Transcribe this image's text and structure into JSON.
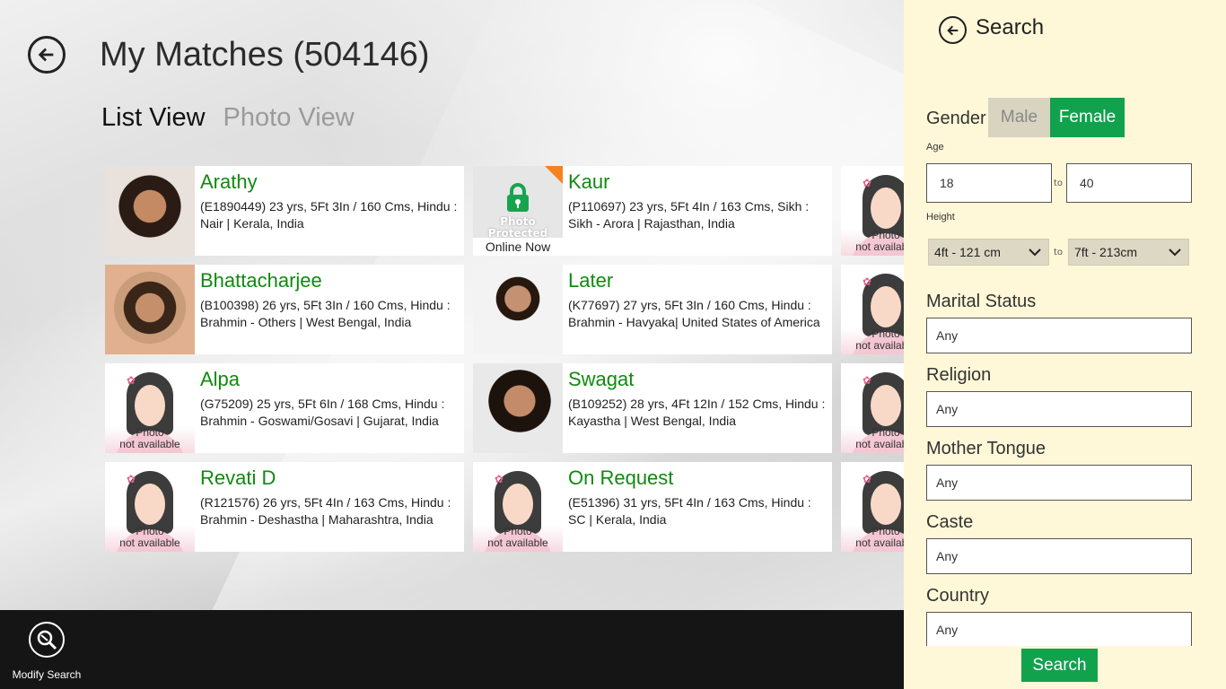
{
  "page": {
    "title": "My Matches (504146)",
    "views": [
      {
        "label": "List View",
        "active": true
      },
      {
        "label": "Photo View",
        "active": false
      }
    ]
  },
  "photo_placeholder": {
    "line1": "Photo",
    "line2": "not available"
  },
  "protected_photo": {
    "text": "Photo Protected",
    "status": "Online Now"
  },
  "matches": [
    {
      "name": "Arathy",
      "details": "(E1890449) 23 yrs, 5Ft 3In / 160 Cms, Hindu : Nair | Kerala, India",
      "photo": "real"
    },
    {
      "name": "Kaur",
      "details": "(P110697) 23 yrs, 5Ft 4In / 163 Cms, Sikh : Sikh - Arora | Rajasthan, India",
      "photo": "protected"
    },
    {
      "name": "Bhattacharjee",
      "details": "(B100398) 26 yrs, 5Ft 3In / 160 Cms, Hindu : Brahmin - Others | West Bengal, India",
      "photo": "real"
    },
    {
      "name": "Later",
      "details": "(K77697) 27 yrs, 5Ft 3In / 160 Cms, Hindu : Brahmin - Havyaka| United States of America",
      "photo": "real"
    },
    {
      "name": "Alpa",
      "details": "(G75209) 25 yrs, 5Ft 6In / 168 Cms, Hindu : Brahmin - Goswami/Gosavi | Gujarat, India",
      "photo": "none"
    },
    {
      "name": "Swagat",
      "details": "(B109252) 28 yrs, 4Ft 12In / 152 Cms, Hindu : Kayastha | West Bengal, India",
      "photo": "real"
    },
    {
      "name": "Revati D",
      "details": "(R121576) 26 yrs, 5Ft 4In / 163 Cms, Hindu : Brahmin - Deshastha | Maharashtra, India",
      "photo": "none"
    },
    {
      "name": "On Request",
      "details": "(E51396) 31 yrs, 5Ft 4In / 163 Cms, Hindu : SC | Kerala, India",
      "photo": "none"
    }
  ],
  "bottom_bar": {
    "modify_search_label": "Modify Search"
  },
  "search_panel": {
    "title": "Search",
    "gender": {
      "label": "Gender",
      "options": [
        "Male",
        "Female"
      ],
      "selected": "Female"
    },
    "age": {
      "label": "Age",
      "from": "18",
      "to": "40",
      "separator": "to"
    },
    "height": {
      "label": "Height",
      "from": "4ft - 121 cm",
      "to": "7ft - 213cm",
      "separator": "to"
    },
    "marital_status": {
      "label": "Marital Status",
      "value": "Any"
    },
    "religion": {
      "label": "Religion",
      "value": "Any"
    },
    "mother_tongue": {
      "label": "Mother Tongue",
      "value": "Any"
    },
    "caste": {
      "label": "Caste",
      "value": "Any"
    },
    "country": {
      "label": "Country",
      "value": "Any"
    },
    "search_button": "Search"
  },
  "colors": {
    "accent_green": "#12a14d",
    "name_green": "#108a10",
    "panel_bg": "#fff8d8",
    "protected_corner": "#f58220"
  }
}
